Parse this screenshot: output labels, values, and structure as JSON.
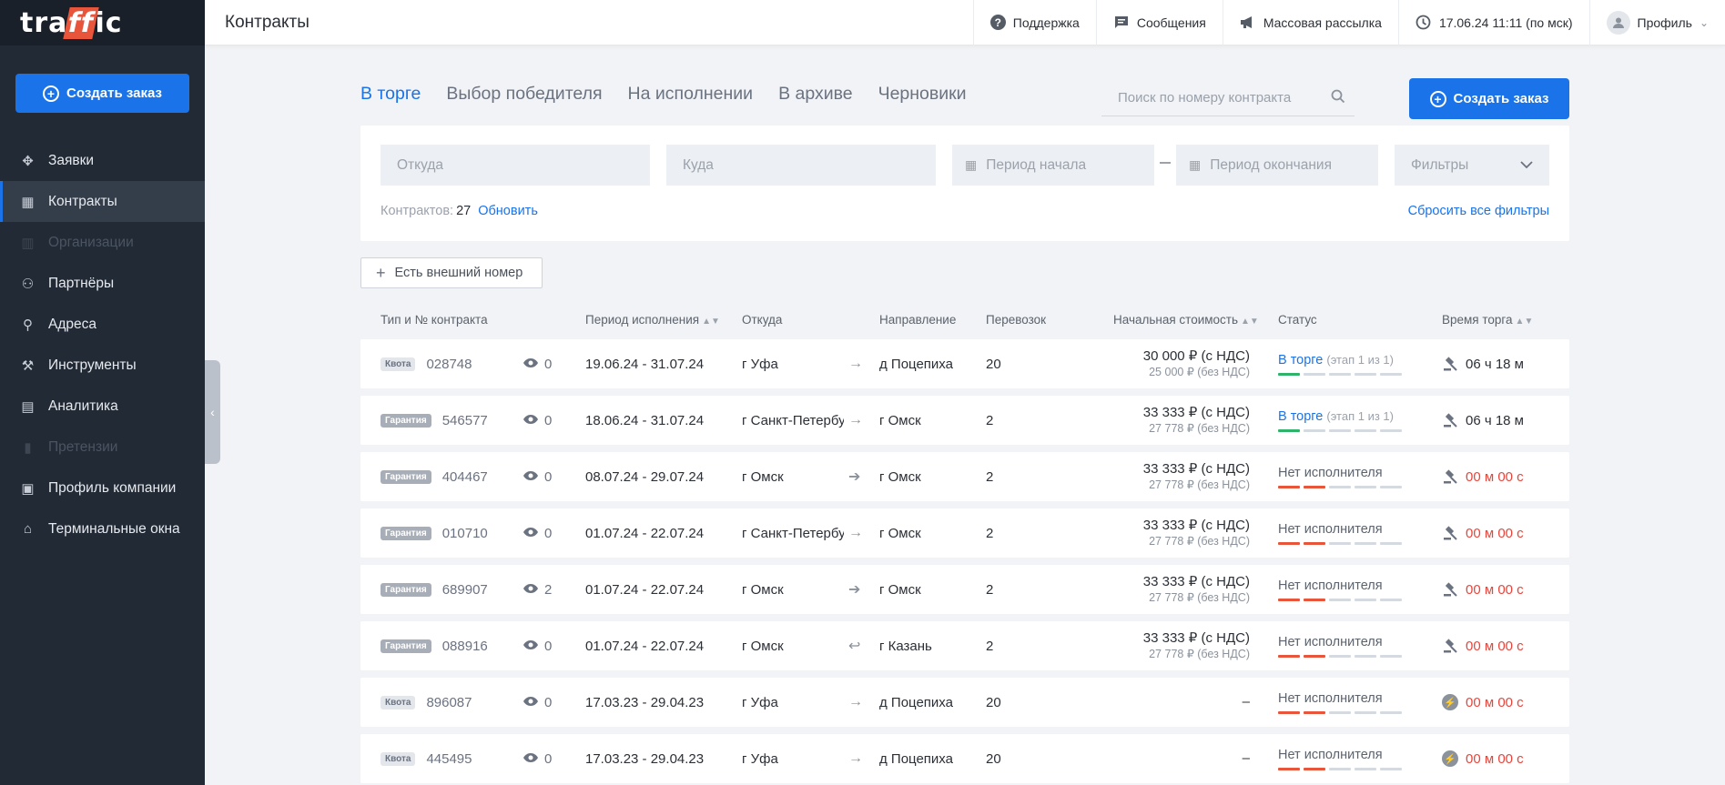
{
  "sidebar": {
    "logo": "traffic",
    "create_button": "Создать заказ",
    "items": [
      {
        "label": "Заявки",
        "icon": "move-icon",
        "active": false,
        "disabled": false
      },
      {
        "label": "Контракты",
        "icon": "calendar-icon",
        "active": true,
        "disabled": false
      },
      {
        "label": "Организации",
        "icon": "building-icon",
        "active": false,
        "disabled": true
      },
      {
        "label": "Партнёры",
        "icon": "handshake-icon",
        "active": false,
        "disabled": false
      },
      {
        "label": "Адреса",
        "icon": "location-person-icon",
        "active": false,
        "disabled": false
      },
      {
        "label": "Инструменты",
        "icon": "tools-icon",
        "active": false,
        "disabled": false
      },
      {
        "label": "Аналитика",
        "icon": "chart-icon",
        "active": false,
        "disabled": false
      },
      {
        "label": "Претензии",
        "icon": "clipboard-icon",
        "active": false,
        "disabled": true
      },
      {
        "label": "Профиль компании",
        "icon": "briefcase-icon",
        "active": false,
        "disabled": false
      },
      {
        "label": "Терминальные окна",
        "icon": "warehouse-icon",
        "active": false,
        "disabled": false
      }
    ]
  },
  "header": {
    "title": "Контракты",
    "support": "Поддержка",
    "messages": "Сообщения",
    "mailing": "Массовая рассылка",
    "datetime": "17.06.24 11:11 (по мск)",
    "profile": "Профиль"
  },
  "tabs": [
    {
      "label": "В торге",
      "active": true
    },
    {
      "label": "Выбор победителя",
      "active": false
    },
    {
      "label": "На исполнении",
      "active": false
    },
    {
      "label": "В архиве",
      "active": false
    },
    {
      "label": "Черновики",
      "active": false
    }
  ],
  "search": {
    "placeholder": "Поиск по номеру контракта"
  },
  "create_button": "Создать заказ",
  "filters": {
    "from": "Откуда",
    "to": "Куда",
    "period_start": "Период начала",
    "period_end": "Период окончания",
    "filters": "Фильтры",
    "count_label": "Контрактов:",
    "count": "27",
    "refresh": "Обновить",
    "reset": "Сбросить все фильтры"
  },
  "external_button": "Есть внешний номер",
  "columns": {
    "type": "Тип и № контракта",
    "period": "Период исполнения",
    "from": "Откуда",
    "direction": "Направление",
    "trips": "Перевозок",
    "cost": "Начальная стоимость",
    "status": "Статус",
    "time": "Время торга"
  },
  "colors": {
    "accent": "#1a73e8",
    "sidebar": "#222a36",
    "green": "#2fb36b",
    "red": "#e8553b"
  },
  "rows": [
    {
      "type": "Квота",
      "number": "028748",
      "views": "0",
      "period": "19.06.24 - 31.07.24",
      "from": "г Уфа",
      "route_icon": "arrow-right-icon",
      "to": "д Поцепиха",
      "trips": "20",
      "cost": "30 000 ₽ (с НДС)",
      "cost_net": "25 000 ₽ (без НДС)",
      "status": "В торге",
      "stage": "(этап 1 из 1)",
      "status_color": "blue",
      "bars": [
        "green",
        "grey",
        "grey",
        "grey",
        "grey"
      ],
      "time_icon": "gavel-icon",
      "time": "06 ч 18 м",
      "time_red": false
    },
    {
      "type": "Гарантия",
      "number": "546577",
      "views": "0",
      "period": "18.06.24 - 31.07.24",
      "from": "г Санкт-Петербург",
      "route_icon": "arrow-right-icon",
      "to": "г Омск",
      "trips": "2",
      "cost": "33 333 ₽ (с НДС)",
      "cost_net": "27 778 ₽ (без НДС)",
      "status": "В торге",
      "stage": "(этап 1 из 1)",
      "status_color": "blue",
      "bars": [
        "green",
        "grey",
        "grey",
        "grey",
        "grey"
      ],
      "time_icon": "gavel-icon",
      "time": "06 ч 18 м",
      "time_red": false
    },
    {
      "type": "Гарантия",
      "number": "404467",
      "views": "0",
      "period": "08.07.24 - 29.07.24",
      "from": "г Омск",
      "route_icon": "arrow-right-multi-icon",
      "to": "г Омск",
      "trips": "2",
      "cost": "33 333 ₽ (с НДС)",
      "cost_net": "27 778 ₽ (без НДС)",
      "status": "Нет исполнителя",
      "stage": "",
      "status_color": "grey",
      "bars": [
        "red",
        "red",
        "grey",
        "grey",
        "grey"
      ],
      "time_icon": "gavel-icon",
      "time": "00 м 00 с",
      "time_red": true
    },
    {
      "type": "Гарантия",
      "number": "010710",
      "views": "0",
      "period": "01.07.24 - 22.07.24",
      "from": "г Санкт-Петербург",
      "route_icon": "arrow-right-icon",
      "to": "г Омск",
      "trips": "2",
      "cost": "33 333 ₽ (с НДС)",
      "cost_net": "27 778 ₽ (без НДС)",
      "status": "Нет исполнителя",
      "stage": "",
      "status_color": "grey",
      "bars": [
        "red",
        "red",
        "grey",
        "grey",
        "grey"
      ],
      "time_icon": "gavel-icon",
      "time": "00 м 00 с",
      "time_red": true
    },
    {
      "type": "Гарантия",
      "number": "689907",
      "views": "2",
      "period": "01.07.24 - 22.07.24",
      "from": "г Омск",
      "route_icon": "arrow-right-multi-icon",
      "to": "г Омск",
      "trips": "2",
      "cost": "33 333 ₽ (с НДС)",
      "cost_net": "27 778 ₽ (без НДС)",
      "status": "Нет исполнителя",
      "stage": "",
      "status_color": "grey",
      "bars": [
        "red",
        "red",
        "grey",
        "grey",
        "grey"
      ],
      "time_icon": "gavel-icon",
      "time": "00 м 00 с",
      "time_red": true
    },
    {
      "type": "Гарантия",
      "number": "088916",
      "views": "0",
      "period": "01.07.24 - 22.07.24",
      "from": "г Омск",
      "route_icon": "return-icon",
      "to": "г Казань",
      "trips": "2",
      "cost": "33 333 ₽ (с НДС)",
      "cost_net": "27 778 ₽ (без НДС)",
      "status": "Нет исполнителя",
      "stage": "",
      "status_color": "grey",
      "bars": [
        "red",
        "red",
        "grey",
        "grey",
        "grey"
      ],
      "time_icon": "gavel-icon",
      "time": "00 м 00 с",
      "time_red": true
    },
    {
      "type": "Квота",
      "number": "896087",
      "views": "0",
      "period": "17.03.23 - 29.04.23",
      "from": "г Уфа",
      "route_icon": "arrow-right-icon",
      "to": "д Поцепиха",
      "trips": "20",
      "cost": "–",
      "cost_net": "",
      "status": "Нет исполнителя",
      "stage": "",
      "status_color": "grey",
      "bars": [
        "red",
        "red",
        "grey",
        "grey",
        "grey"
      ],
      "time_icon": "lightning-icon",
      "time": "00 м 00 с",
      "time_red": true
    },
    {
      "type": "Квота",
      "number": "445495",
      "views": "0",
      "period": "17.03.23 - 29.04.23",
      "from": "г Уфа",
      "route_icon": "arrow-right-icon",
      "to": "д Поцепиха",
      "trips": "20",
      "cost": "–",
      "cost_net": "",
      "status": "Нет исполнителя",
      "stage": "",
      "status_color": "grey",
      "bars": [
        "red",
        "red",
        "grey",
        "grey",
        "grey"
      ],
      "time_icon": "lightning-icon",
      "time": "00 м 00 с",
      "time_red": true
    }
  ]
}
